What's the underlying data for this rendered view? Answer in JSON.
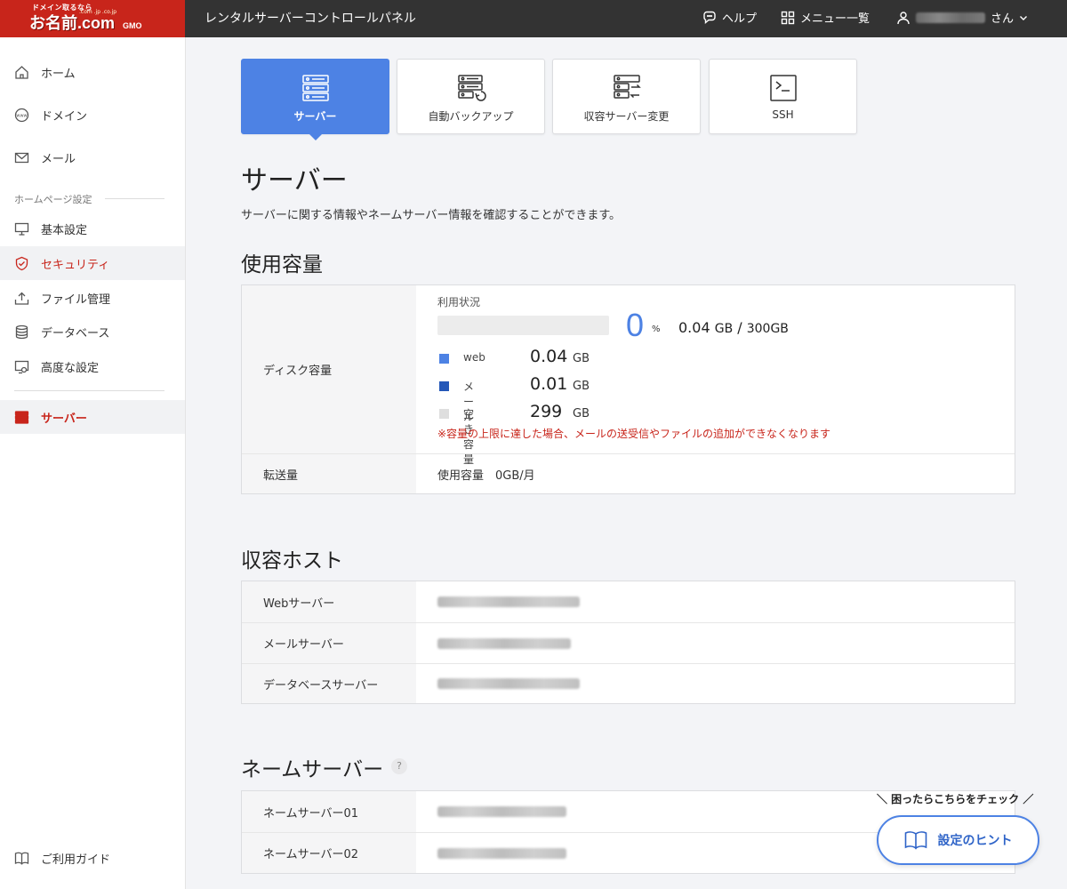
{
  "header": {
    "logo_tagline": "ドメイン取るなら",
    "logo_brand": "お名前.com",
    "logo_sub": ".com .jp .co.jp",
    "logo_gmo": "GMO",
    "app_title": "レンタルサーバーコントロールパネル",
    "help_label": "ヘルプ",
    "menu_label": "メニュー一覧",
    "user_suffix": "さん"
  },
  "sidebar": {
    "items_top": [
      {
        "label": "ホーム",
        "icon": "home-icon"
      },
      {
        "label": "ドメイン",
        "icon": "www-icon"
      },
      {
        "label": "メール",
        "icon": "mail-icon"
      }
    ],
    "section_label": "ホームページ設定",
    "items_site": [
      {
        "label": "基本設定",
        "icon": "monitor-icon"
      },
      {
        "label": "セキュリティ",
        "icon": "shield-icon"
      },
      {
        "label": "ファイル管理",
        "icon": "upload-icon"
      },
      {
        "label": "データベース",
        "icon": "database-icon"
      },
      {
        "label": "高度な設定",
        "icon": "settings-monitor-icon"
      }
    ],
    "server_label": "サーバー",
    "guide_label": "ご利用ガイド"
  },
  "tabs": [
    {
      "label": "サーバー",
      "icon": "server-icon",
      "active": true
    },
    {
      "label": "自動バックアップ",
      "icon": "backup-icon",
      "active": false
    },
    {
      "label": "収容サーバー変更",
      "icon": "server-switch-icon",
      "active": false
    },
    {
      "label": "SSH",
      "icon": "terminal-icon",
      "active": false
    }
  ],
  "page": {
    "title": "サーバー",
    "description": "サーバーに関する情報やネームサーバー情報を確認することができます。"
  },
  "usage": {
    "section_title": "使用容量",
    "disk_label": "ディスク容量",
    "status_label": "利用状況",
    "percent": "0",
    "percent_sign": "%",
    "used": "0.04",
    "used_unit": "GB",
    "total": "300GB",
    "legend": [
      {
        "name": "web",
        "value": "0.04",
        "unit": "GB",
        "color": "#4d82e4"
      },
      {
        "name": "メール",
        "value": "0.01",
        "unit": "GB",
        "color": "#2457b8"
      },
      {
        "name": "空き容量",
        "value": "299",
        "unit": "GB",
        "color": "#dedede"
      }
    ],
    "warning": "※容量の上限に達した場合、メールの送受信やファイルの追加ができなくなります",
    "transfer_label": "転送量",
    "transfer_value": "使用容量　0GB/月"
  },
  "hosts": {
    "section_title": "収容ホスト",
    "rows": [
      {
        "label": "Webサーバー"
      },
      {
        "label": "メールサーバー"
      },
      {
        "label": "データベースサーバー"
      }
    ]
  },
  "nameservers": {
    "section_title": "ネームサーバー",
    "help": "?",
    "rows": [
      {
        "label": "ネームサーバー01"
      },
      {
        "label": "ネームサーバー02"
      }
    ]
  },
  "hint": {
    "caption": "＼ 困ったらこちらをチェック ／",
    "button_label": "設定のヒント"
  },
  "colors": {
    "brand_red": "#c8251b",
    "accent_blue": "#4d82e4",
    "header_bg": "#333333"
  }
}
